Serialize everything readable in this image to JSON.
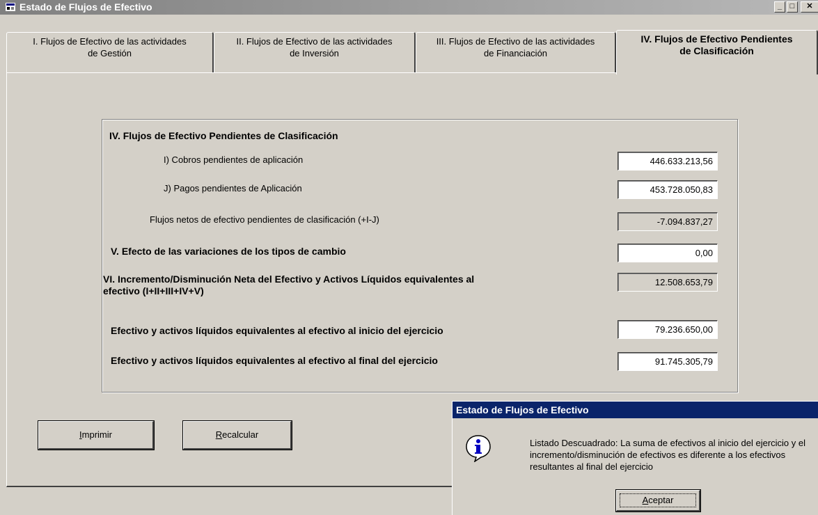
{
  "window": {
    "title": "Estado de Flujos de Efectivo"
  },
  "tabs": [
    {
      "line1": "I. Flujos de Efectivo de las actividades",
      "line2": "de Gestión"
    },
    {
      "line1": "II. Flujos de Efectivo de las actividades",
      "line2": "de Inversión"
    },
    {
      "line1": "III. Flujos de Efectivo de las actividades",
      "line2": "de Financiación"
    },
    {
      "line1": "IV. Flujos de Efectivo Pendientes",
      "line2": "de Clasificación"
    }
  ],
  "section": {
    "heading": "IV. Flujos de Efectivo Pendientes de Clasificación",
    "cobros_label": "I) Cobros pendientes de aplicación",
    "cobros_value": "446.633.213,56",
    "pagos_label": "J) Pagos pendientes de Aplicación",
    "pagos_value": "453.728.050,83",
    "netos_label": "Flujos netos de efectivo pendientes de clasificación (+I-J)",
    "netos_value": "-7.094.837,27",
    "efecto_label": "V. Efecto de las variaciones de los tipos de cambio",
    "efecto_value": "0,00",
    "incremento_label_1": "VI. Incremento/Disminución Neta del Efectivo y Activos Líquidos equivalentes al",
    "incremento_label_2": "efectivo (I+II+III+IV+V)",
    "incremento_value": "12.508.653,79",
    "inicio_label": "Efectivo y activos líquidos equivalentes al efectivo al inicio del ejercicio",
    "inicio_value": "79.236.650,00",
    "final_label": "Efectivo y activos líquidos equivalentes al efectivo al final del ejercicio",
    "final_value": "91.745.305,79"
  },
  "buttons": {
    "imprimir_accel": "I",
    "imprimir_rest": "mprimir",
    "recalcular_accel": "R",
    "recalcular_rest": "ecalcular"
  },
  "dialog": {
    "title": "Estado de Flujos de Efectivo",
    "message": "Listado Descuadrado: La suma de efectivos al inicio del ejercicio y el incremento/disminución de efectivos es diferente a los efectivos resultantes al final del ejercicio",
    "ok_accel": "A",
    "ok_rest": "ceptar",
    "icon": "info-icon"
  },
  "colors": {
    "dialog_title_bg": "#0a246a",
    "window_bg": "#d4d0c8",
    "inactive_title": "#808080"
  }
}
